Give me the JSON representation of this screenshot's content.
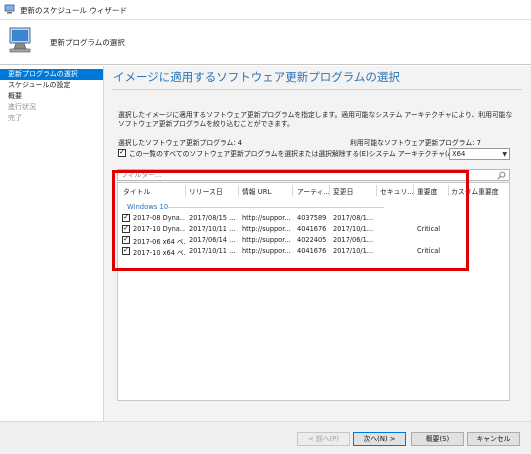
{
  "window": {
    "title": "更新のスケジュール ウィザード"
  },
  "header": {
    "title": "更新プログラムの選択"
  },
  "nav": {
    "items": [
      {
        "label": "更新プログラムの選択"
      },
      {
        "label": "スケジュールの設定"
      },
      {
        "label": "概要"
      },
      {
        "label": "進行状況"
      },
      {
        "label": "完了"
      }
    ]
  },
  "main": {
    "heading": "イメージに適用するソフトウェア更新プログラムの選択",
    "description": "選択したイメージに適用するソフトウェア更新プログラムを指定します。適用可能なシステム アーキテクチャにより、利用可能なソフトウェア更新プログラムを絞り込むことができます。",
    "selected_count": "選択したソフトウェア更新プログラム: 4",
    "available_count": "利用可能なソフトウェア更新プログラム: 7",
    "select_all_label": "この一覧のすべてのソフトウェア更新プログラムを選択または選択解除する(E)",
    "arch_label": "システム アーキテクチャ(A):",
    "arch_value": "X64",
    "filter_placeholder": "フィルター..."
  },
  "grid": {
    "columns": [
      "タイトル",
      "リリース日",
      "情報 URL",
      "アーティ...",
      "変更日",
      "セキュリ...",
      "重要度",
      "カスタム重要度"
    ],
    "group": "Windows 10",
    "rows": [
      {
        "checked": true,
        "title": "2017-08 Dyna...",
        "release": "2017/08/15 ...",
        "url": "http://suppor...",
        "article": "4037589",
        "modified": "2017/08/1...",
        "security": "",
        "severity": "",
        "custom": ""
      },
      {
        "checked": true,
        "title": "2017-10 Dyna...",
        "release": "2017/10/11 ...",
        "url": "http://suppor...",
        "article": "4041676",
        "modified": "2017/10/1...",
        "security": "",
        "severity": "Critical",
        "custom": ""
      },
      {
        "checked": true,
        "title": "2017-06 x64 ベ...",
        "release": "2017/06/14 ...",
        "url": "http://suppor...",
        "article": "4022405",
        "modified": "2017/06/1...",
        "security": "",
        "severity": "",
        "custom": ""
      },
      {
        "checked": true,
        "title": "2017-10 x64 ベ...",
        "release": "2017/10/11 ...",
        "url": "http://suppor...",
        "article": "4041676",
        "modified": "2017/10/1...",
        "security": "",
        "severity": "Critical",
        "custom": ""
      }
    ]
  },
  "footer": {
    "back": "< 前へ(P)",
    "next": "次へ(N) >",
    "summary": "概要(S)",
    "cancel": "キャンセル"
  },
  "colors": {
    "accent": "#0078d7",
    "heading": "#2a73b8",
    "highlight_box": "#e00000"
  },
  "icons": {
    "window": "computer-icon",
    "header": "computer-wizard-icon",
    "filter": "search-icon"
  }
}
